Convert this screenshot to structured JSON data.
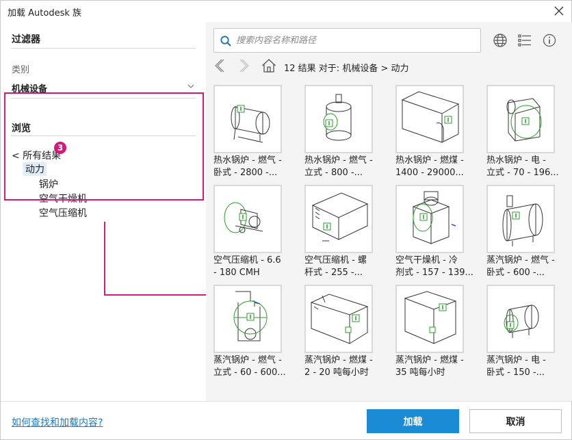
{
  "window": {
    "title": "加载 Autodesk 族"
  },
  "filters": {
    "heading": "过滤器",
    "category_label": "类别",
    "category_value": "机械设备"
  },
  "browse": {
    "heading": "浏览",
    "all_results": "< 所有结果",
    "selected": "动力",
    "badge": "3",
    "children": [
      "锅炉",
      "空气干燥机",
      "空气压缩机"
    ]
  },
  "search": {
    "placeholder": "搜索内容名称和路径",
    "value": ""
  },
  "breadcrumb": "12 结果  对于:  机械设备 > 动力",
  "items": [
    {
      "line1": "热水锅炉 - 燃气 -",
      "line2": "卧式 - 2800 -..."
    },
    {
      "line1": "热水锅炉 - 燃气 -",
      "line2": "立式 - 800 -..."
    },
    {
      "line1": "热水锅炉 - 燃煤 -",
      "line2": "1400 - 29000..."
    },
    {
      "line1": "热水锅炉 - 电 -",
      "line2": "立式 - 70 - 196..."
    },
    {
      "line1": "空气压缩机 - 6.6",
      "line2": "- 180 CMH"
    },
    {
      "line1": "空气压缩机 - 螺",
      "line2": "杆式 - 255 -..."
    },
    {
      "line1": "空气干燥机 - 冷",
      "line2": "剂式 - 157 - 139..."
    },
    {
      "line1": "蒸汽锅炉 - 燃气 -",
      "line2": "卧式 - 600 -..."
    },
    {
      "line1": "蒸汽锅炉 - 燃气 -",
      "line2": "立式 - 60 - 600..."
    },
    {
      "line1": "蒸汽锅炉 - 燃煤 -",
      "line2": "2 - 20 吨每小时"
    },
    {
      "line1": "蒸汽锅炉 - 燃煤 -",
      "line2": "35 吨每小时"
    },
    {
      "line1": "蒸汽锅炉 - 电 -",
      "line2": "卧式 - 150 -..."
    }
  ],
  "footer": {
    "help_link": "如何查找和加载内容?",
    "load_button": "加载",
    "cancel_button": "取消"
  },
  "colors": {
    "accent": "#1b8bd5",
    "highlight": "#d4197a",
    "connector_green": "#2a9d2a"
  },
  "icons": [
    "close-icon",
    "chevron-down-icon",
    "search-icon",
    "globe-icon",
    "list-view-icon",
    "info-icon",
    "back-arrow-icon",
    "forward-arrow-icon",
    "home-icon"
  ]
}
